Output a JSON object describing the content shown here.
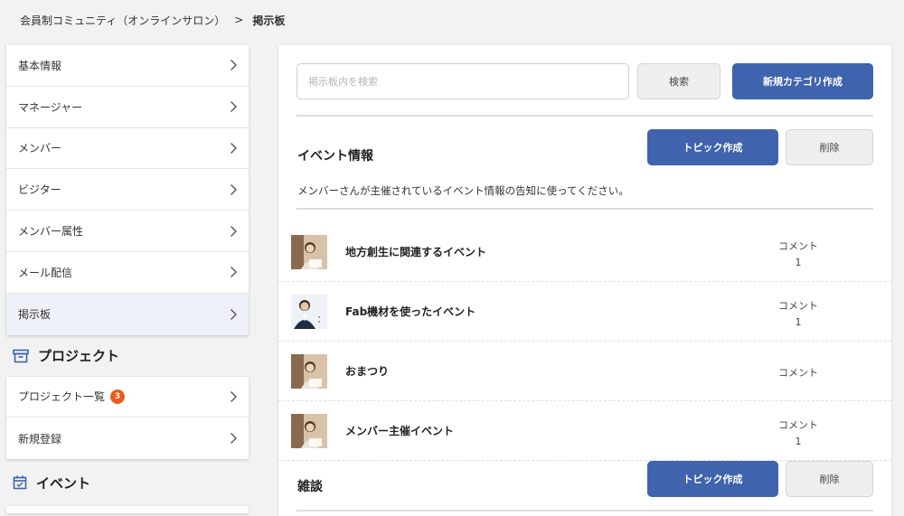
{
  "breadcrumb": {
    "parent": "会員制コミュニティ（オンラインサロン）",
    "separator": ">",
    "current": "掲示板"
  },
  "sidebar": {
    "menu": [
      {
        "label": "基本情報"
      },
      {
        "label": "マネージャー"
      },
      {
        "label": "メンバー"
      },
      {
        "label": "ビジター"
      },
      {
        "label": "メンバー属性"
      },
      {
        "label": "メール配信"
      },
      {
        "label": "掲示板",
        "active": true
      }
    ],
    "project": {
      "title": "プロジェクト",
      "items": [
        {
          "label": "プロジェクト一覧",
          "badge": "3"
        },
        {
          "label": "新規登録"
        }
      ]
    },
    "event": {
      "title": "イベント"
    }
  },
  "search": {
    "placeholder": "掲示板内を検索",
    "value": "",
    "search_label": "検索",
    "new_category_label": "新規カテゴリ作成"
  },
  "categories": [
    {
      "title": "イベント情報",
      "description": "メンバーさんが主催されているイベント情報の告知に使ってください。",
      "create_topic_label": "トピック作成",
      "delete_label": "削除",
      "topics": [
        {
          "title": "地方創生に関連するイベント",
          "comment_label": "コメント",
          "comment_count": "1"
        },
        {
          "title": "Fab機材を使ったイベント",
          "comment_label": "コメント",
          "comment_count": "1"
        },
        {
          "title": "おまつり",
          "comment_label": "コメント",
          "comment_count": ""
        },
        {
          "title": "メンバー主催イベント",
          "comment_label": "コメント",
          "comment_count": "1"
        }
      ]
    },
    {
      "title": "雑談",
      "create_topic_label": "トピック作成",
      "delete_label": "削除"
    }
  ],
  "colors": {
    "accent": "#3f63ad",
    "badge": "#e85d1a",
    "icon": "#3f63ad"
  }
}
